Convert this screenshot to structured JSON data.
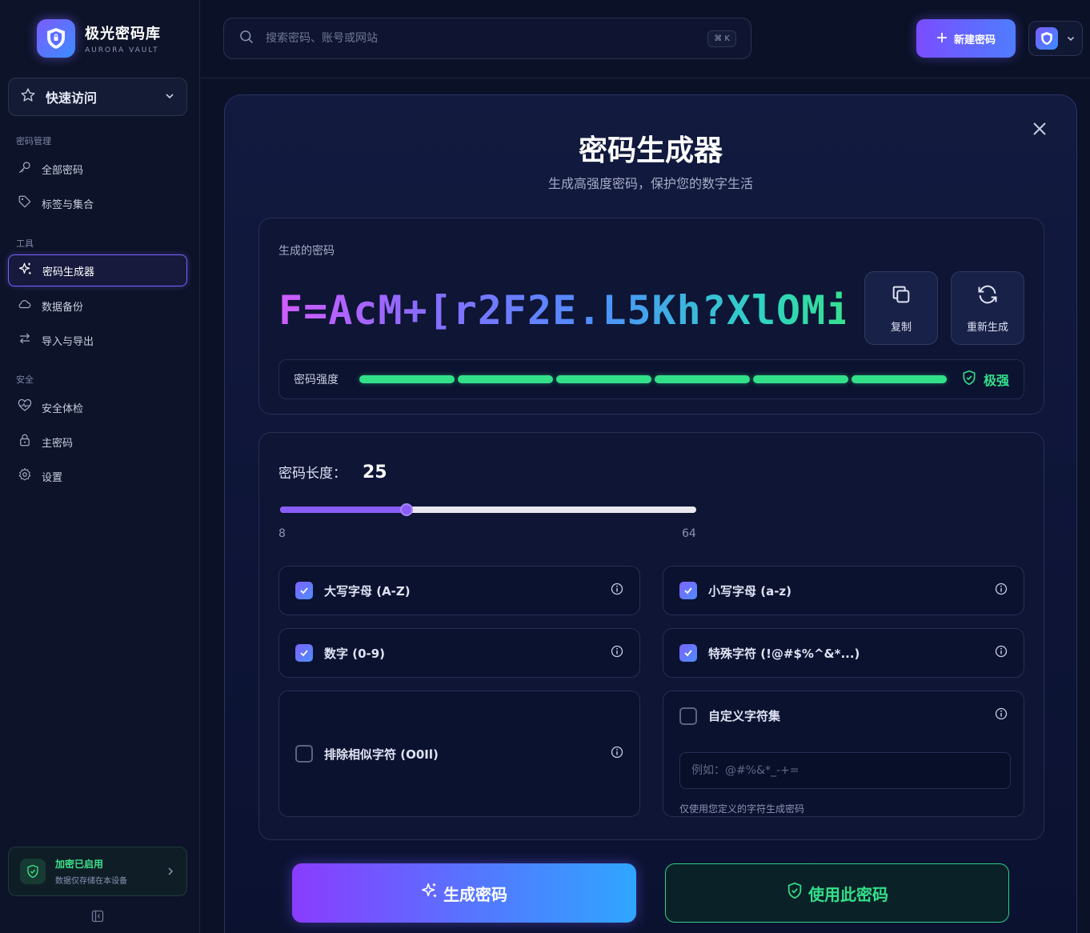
{
  "brand": {
    "title": "极光密码库",
    "subtitle": "AURORA VAULT"
  },
  "quick_access": {
    "label": "快速访问"
  },
  "sidebar": {
    "sections": [
      {
        "title": "密码管理",
        "items": [
          {
            "label": "全部密码",
            "icon": "key-icon"
          },
          {
            "label": "标签与集合",
            "icon": "tag-icon"
          }
        ]
      },
      {
        "title": "工具",
        "items": [
          {
            "label": "密码生成器",
            "icon": "sparkle-icon",
            "active": true
          },
          {
            "label": "数据备份",
            "icon": "cloud-icon"
          },
          {
            "label": "导入与导出",
            "icon": "swap-icon"
          }
        ]
      },
      {
        "title": "安全",
        "items": [
          {
            "label": "安全体检",
            "icon": "heart-pulse-icon"
          },
          {
            "label": "主密码",
            "icon": "lock-icon"
          },
          {
            "label": "设置",
            "icon": "gear-icon"
          }
        ]
      }
    ],
    "encryption": {
      "title": "加密已启用",
      "subtitle": "数据仅存储在本设备"
    }
  },
  "search": {
    "placeholder": "搜索密码、账号或网站",
    "shortcut": "⌘ K"
  },
  "header": {
    "new_button": "新建密码"
  },
  "modal": {
    "title": "密码生成器",
    "subtitle": "生成高强度密码，保护您的数字生活",
    "generated_label": "生成的密码",
    "password": "F=AcM+[r2F2E.L5Kh?XlOMi",
    "copy_label": "复制",
    "regenerate_label": "重新生成",
    "strength_label": "密码强度",
    "strength_level": "极强",
    "strength_segments_total": 6,
    "strength_segments_on": 6,
    "length_label": "密码长度：",
    "length_value": "25",
    "length_min": "8",
    "length_max": "64",
    "options": {
      "uppercase": {
        "label": "大写字母 (A-Z)",
        "checked": true
      },
      "lowercase": {
        "label": "小写字母 (a-z)",
        "checked": true
      },
      "digits": {
        "label": "数字 (0-9)",
        "checked": true
      },
      "special": {
        "label": "特殊字符 (!@#$%^&*...)",
        "checked": true
      },
      "exclude_similar": {
        "label": "排除相似字符 (O0Il)",
        "checked": false
      },
      "custom": {
        "label": "自定义字符集",
        "checked": false,
        "placeholder": "例如：@#%&*_-+=",
        "hint": "仅使用您定义的字符生成密码"
      }
    },
    "generate_button": "生成密码",
    "use_button": "使用此密码"
  },
  "colors": {
    "accent": "#7b63ff",
    "success": "#33e08a",
    "background": "#0b1126"
  }
}
